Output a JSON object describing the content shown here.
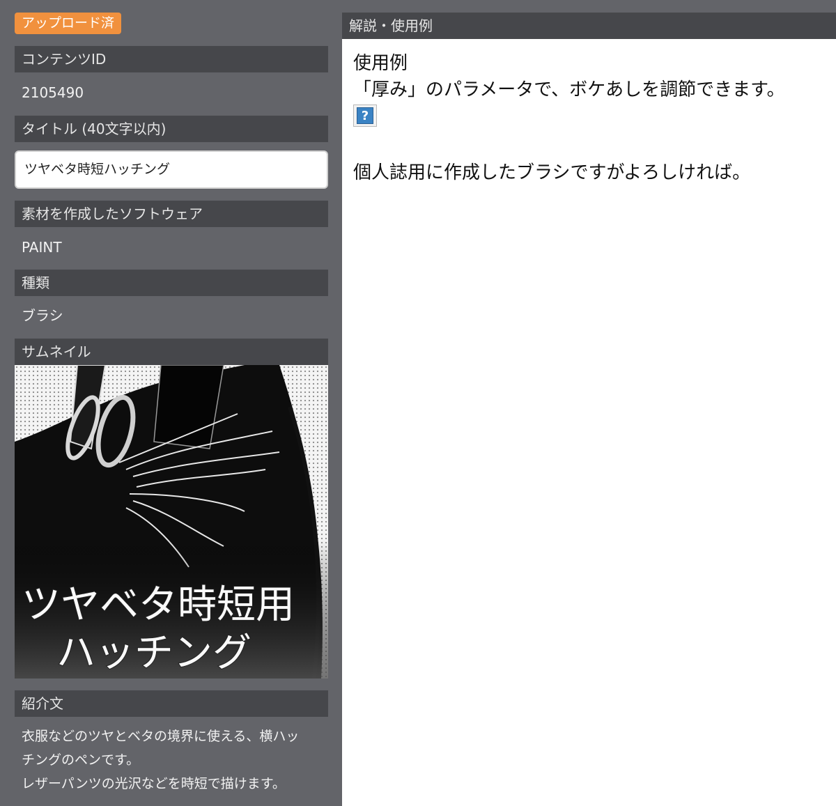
{
  "status_badge": "アップロード済",
  "fields": {
    "content_id_label": "コンテンツID",
    "content_id_value": "2105490",
    "title_label": "タイトル (40文字以内)",
    "title_value": "ツヤベタ時短ハッチング",
    "software_label": "素材を作成したソフトウェア",
    "software_value": "PAINT",
    "type_label": "種類",
    "type_value": "ブラシ",
    "thumbnail_label": "サムネイル",
    "intro_label": "紹介文"
  },
  "thumbnail": {
    "text_line1": "ツヤベタ時短用",
    "text_line2": "ハッチング"
  },
  "intro_lines": [
    "衣服などのツヤとベタの境界に使える、横ハッ",
    "チングのペンです。",
    "レザーパンツの光沢などを時短で描けます。"
  ],
  "description": {
    "header": "解説・使用例",
    "line1": "使用例",
    "line2": "「厚み」のパラメータで、ボケあしを調節できます。",
    "image_placeholder_icon": "question-mark-icon",
    "line3": "個人誌用に作成したブラシですがよろしければ。"
  }
}
